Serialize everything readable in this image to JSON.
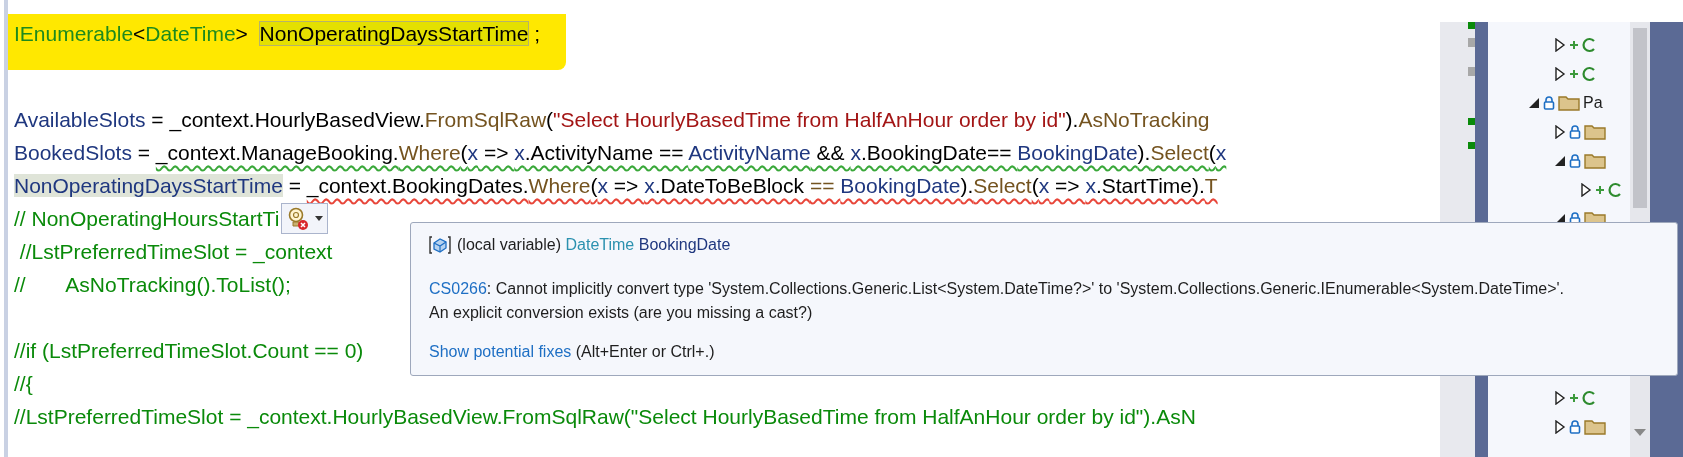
{
  "code": {
    "blocks": [
      {
        "lines": [
          {
            "marker": true,
            "lightbulb": false,
            "tokens": [
              {
                "kind": "type",
                "text": "IEnumerable"
              },
              {
                "kind": "plain",
                "text": "<"
              },
              {
                "kind": "type",
                "text": "DateTime"
              },
              {
                "kind": "plain",
                "text": ">  "
              },
              {
                "kind": "definition",
                "text": "NonOperatingDaysStartTime"
              },
              {
                "kind": "plain",
                "text": " ;"
              }
            ]
          }
        ]
      },
      {
        "lines": [
          {
            "marker": false,
            "lightbulb": false,
            "tokens": [
              {
                "kind": "variable",
                "text": "AvailableSlots"
              },
              {
                "kind": "plain",
                "text": " = _context.HourlyBasedView."
              },
              {
                "kind": "method",
                "text": "FromSqlRaw"
              },
              {
                "kind": "plain",
                "text": "("
              },
              {
                "kind": "string",
                "text": "\"Select HourlyBasedTime from HalfAnHour order by id\""
              },
              {
                "kind": "plain",
                "text": ")."
              },
              {
                "kind": "method",
                "text": "AsNoTracking"
              }
            ]
          },
          {
            "marker": false,
            "lightbulb": false,
            "tokens": [
              {
                "kind": "variable",
                "text": "BookedSlots"
              },
              {
                "kind": "plain",
                "text": " = "
              }
            ],
            "squiggle": {
              "kind": "warning",
              "tokens": [
                {
                  "kind": "plain",
                  "text": "_context.ManageBooking."
                },
                {
                  "kind": "method",
                  "text": "Where"
                },
                {
                  "kind": "plain",
                  "text": "("
                },
                {
                  "kind": "variable",
                  "text": "x"
                },
                {
                  "kind": "plain",
                  "text": " => "
                },
                {
                  "kind": "variable",
                  "text": "x"
                },
                {
                  "kind": "plain",
                  "text": ".ActivityName == "
                },
                {
                  "kind": "variable",
                  "text": "ActivityName"
                },
                {
                  "kind": "plain",
                  "text": " && "
                },
                {
                  "kind": "variable",
                  "text": "x"
                },
                {
                  "kind": "plain",
                  "text": ".BookingDate== "
                },
                {
                  "kind": "variable",
                  "text": "BookingDate"
                },
                {
                  "kind": "plain",
                  "text": ")."
                },
                {
                  "kind": "method",
                  "text": "Select"
                },
                {
                  "kind": "plain",
                  "text": "("
                },
                {
                  "kind": "variable",
                  "text": "x"
                }
              ]
            }
          },
          {
            "marker": false,
            "lightbulb": false,
            "tokens": [
              {
                "kind": "reference",
                "text": "NonOperatingDaysStartTime"
              },
              {
                "kind": "plain",
                "text": " = "
              }
            ],
            "squiggle": {
              "kind": "error",
              "tokens": [
                {
                  "kind": "plain",
                  "text": "_context.BookingDates."
                },
                {
                  "kind": "method",
                  "text": "Where"
                },
                {
                  "kind": "plain",
                  "text": "("
                },
                {
                  "kind": "variable",
                  "text": "x"
                },
                {
                  "kind": "plain",
                  "text": " => "
                },
                {
                  "kind": "variable",
                  "text": "x"
                },
                {
                  "kind": "plain",
                  "text": ".DateToBeBlock "
                },
                {
                  "kind": "method",
                  "text": "== "
                },
                {
                  "kind": "variable",
                  "text": "BookingDate"
                },
                {
                  "kind": "plain",
                  "text": ")."
                },
                {
                  "kind": "method",
                  "text": "Select"
                },
                {
                  "kind": "plain",
                  "text": "("
                },
                {
                  "kind": "variable",
                  "text": "x"
                },
                {
                  "kind": "plain",
                  "text": " => "
                },
                {
                  "kind": "variable",
                  "text": "x"
                },
                {
                  "kind": "plain",
                  "text": ".StartTime)."
                },
                {
                  "kind": "method",
                  "text": "T"
                }
              ]
            }
          },
          {
            "marker": false,
            "lightbulb": true,
            "tokens": [
              {
                "kind": "comment",
                "text": "// NonOperatingHoursStartTi"
              }
            ]
          },
          {
            "marker": false,
            "lightbulb": false,
            "tokens": [
              {
                "kind": "comment",
                "text": " //LstPreferredTimeSlot = _context"
              }
            ]
          },
          {
            "marker": false,
            "lightbulb": false,
            "tokens": [
              {
                "kind": "comment",
                "text": "//       AsNoTracking().ToList();"
              }
            ]
          }
        ]
      },
      {
        "lines": [
          {
            "marker": false,
            "lightbulb": false,
            "tokens": [
              {
                "kind": "comment",
                "text": "//if (LstPreferredTimeSlot.Count == 0)"
              }
            ]
          },
          {
            "marker": false,
            "lightbulb": false,
            "tokens": [
              {
                "kind": "comment",
                "text": "//{"
              }
            ]
          },
          {
            "marker": false,
            "lightbulb": false,
            "tokens": [
              {
                "kind": "comment",
                "text": "//LstPreferredTimeSlot = _context.HourlyBasedView.FromSqlRaw(\"Select HourlyBasedTime from HalfAnHour order by id\").AsN"
              }
            ]
          }
        ]
      }
    ]
  },
  "quick_info": {
    "prefix": "(local variable)",
    "type": "DateTime",
    "name": "BookingDate"
  },
  "diagnostic": {
    "code": "CS0266",
    "message": ": Cannot implicitly convert type 'System.Collections.Generic.List<System.DateTime?>' to 'System.Collections.Generic.IEnumerable<System.DateTime>'.",
    "detail": "An explicit conversion exists (are you missing a cast?)"
  },
  "fixes": {
    "link": "Show potential fixes",
    "shortcut": "(Alt+Enter or Ctrl+.)"
  },
  "explorer": {
    "tree": [
      {
        "kind": "csharp-file",
        "expanded": false,
        "locked": false,
        "added": true
      },
      {
        "kind": "csharp-file",
        "expanded": false,
        "locked": false,
        "added": true
      },
      {
        "kind": "folder",
        "label": "Pa",
        "expanded": true,
        "locked": true,
        "added": false,
        "children": [
          {
            "kind": "folder",
            "expanded": false,
            "locked": true,
            "added": false
          },
          {
            "kind": "folder",
            "expanded": true,
            "locked": true,
            "added": false,
            "children": [
              {
                "kind": "csharp-file",
                "expanded": false,
                "locked": false,
                "added": true
              }
            ]
          },
          {
            "kind": "folder",
            "expanded": true,
            "locked": true,
            "added": false
          }
        ]
      }
    ],
    "tree_tail": [
      {
        "kind": "csharp-file",
        "expanded": false,
        "locked": false,
        "added": true
      },
      {
        "kind": "folder",
        "expanded": false,
        "locked": true,
        "added": false
      }
    ]
  }
}
